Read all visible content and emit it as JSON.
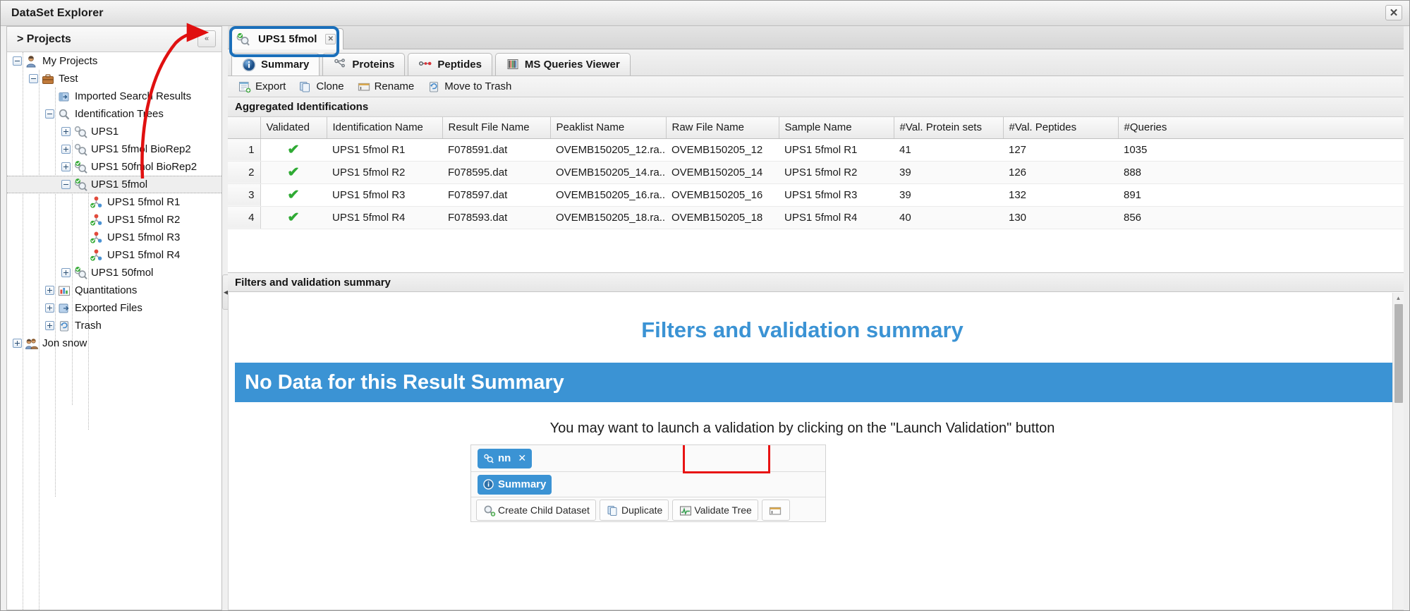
{
  "window": {
    "title": "DataSet Explorer",
    "close_label": "✕"
  },
  "sidebar": {
    "header": "> Projects",
    "collapse_icon": "«",
    "items": [
      {
        "label": "My Projects",
        "icon": "user-icon",
        "indent": 0,
        "toggle": "minus",
        "selected": false
      },
      {
        "label": "Test",
        "icon": "briefcase-icon",
        "indent": 1,
        "toggle": "minus",
        "selected": false
      },
      {
        "label": "Imported Search Results",
        "icon": "import-icon",
        "indent": 2,
        "toggle": "none",
        "selected": false
      },
      {
        "label": "Identification Trees",
        "icon": "magnifier-icon",
        "indent": 2,
        "toggle": "minus",
        "selected": false
      },
      {
        "label": "UPS1",
        "icon": "id-tree-icon",
        "indent": 3,
        "toggle": "plus",
        "selected": false
      },
      {
        "label": "UPS1 5fmol BioRep2",
        "icon": "id-tree-icon",
        "indent": 3,
        "toggle": "plus",
        "selected": false
      },
      {
        "label": "UPS1 50fmol BioRep2",
        "icon": "id-tree-valid-icon",
        "indent": 3,
        "toggle": "plus",
        "selected": false
      },
      {
        "label": "UPS1 5fmol",
        "icon": "id-tree-valid-icon",
        "indent": 3,
        "toggle": "minus",
        "selected": true
      },
      {
        "label": "UPS1 5fmol R1",
        "icon": "rset-valid-icon",
        "indent": 4,
        "toggle": "none",
        "selected": false
      },
      {
        "label": "UPS1 5fmol R2",
        "icon": "rset-valid-icon",
        "indent": 4,
        "toggle": "none",
        "selected": false
      },
      {
        "label": "UPS1 5fmol R3",
        "icon": "rset-valid-icon",
        "indent": 4,
        "toggle": "none",
        "selected": false
      },
      {
        "label": "UPS1 5fmol R4",
        "icon": "rset-valid-icon",
        "indent": 4,
        "toggle": "none",
        "selected": false
      },
      {
        "label": "UPS1 50fmol",
        "icon": "id-tree-valid-icon",
        "indent": 3,
        "toggle": "plus",
        "selected": false
      },
      {
        "label": "Quantitations",
        "icon": "barchart-icon",
        "indent": 2,
        "toggle": "plus",
        "selected": false
      },
      {
        "label": "Exported Files",
        "icon": "exported-files-icon",
        "indent": 2,
        "toggle": "plus",
        "selected": false
      },
      {
        "label": "Trash",
        "icon": "trash-icon",
        "indent": 2,
        "toggle": "plus",
        "selected": false
      },
      {
        "label": "Jon snow",
        "icon": "users-icon",
        "indent": 0,
        "toggle": "plus",
        "selected": false
      }
    ]
  },
  "document_tab": {
    "label": "UPS1 5fmol",
    "icon": "id-tree-valid-icon",
    "close_label": "✕"
  },
  "inner_tabs": [
    {
      "label": "Summary",
      "icon": "info-icon",
      "active": true
    },
    {
      "label": "Proteins",
      "icon": "proteins-icon",
      "active": false
    },
    {
      "label": "Peptides",
      "icon": "peptides-icon",
      "active": false
    },
    {
      "label": "MS Queries Viewer",
      "icon": "ms-queries-icon",
      "active": false
    }
  ],
  "toolbar": [
    {
      "label": "Export",
      "icon": "export-icon"
    },
    {
      "label": "Clone",
      "icon": "clone-icon"
    },
    {
      "label": "Rename",
      "icon": "rename-icon"
    },
    {
      "label": "Move to Trash",
      "icon": "trash-icon"
    }
  ],
  "aggregated": {
    "section_title": "Aggregated Identifications",
    "columns": [
      "",
      "Validated",
      "Identification Name",
      "Result File Name",
      "Peaklist Name",
      "Raw File Name",
      "Sample Name",
      "#Val. Protein sets",
      "#Val. Peptides",
      "#Queries"
    ],
    "rows": [
      {
        "num": "1",
        "validated": "✔",
        "identification_name": "UPS1 5fmol R1",
        "result_file_name": "F078591.dat",
        "peaklist_name": "OVEMB150205_12.ra...",
        "raw_file_name": "OVEMB150205_12",
        "sample_name": "UPS1 5fmol R1",
        "val_protein_sets": "41",
        "val_peptides": "127",
        "queries": "1035"
      },
      {
        "num": "2",
        "validated": "✔",
        "identification_name": "UPS1 5fmol R2",
        "result_file_name": "F078595.dat",
        "peaklist_name": "OVEMB150205_14.ra...",
        "raw_file_name": "OVEMB150205_14",
        "sample_name": "UPS1 5fmol R2",
        "val_protein_sets": "39",
        "val_peptides": "126",
        "queries": "888"
      },
      {
        "num": "3",
        "validated": "✔",
        "identification_name": "UPS1 5fmol R3",
        "result_file_name": "F078597.dat",
        "peaklist_name": "OVEMB150205_16.ra...",
        "raw_file_name": "OVEMB150205_16",
        "sample_name": "UPS1 5fmol R3",
        "val_protein_sets": "39",
        "val_peptides": "132",
        "queries": "891"
      },
      {
        "num": "4",
        "validated": "✔",
        "identification_name": "UPS1 5fmol R4",
        "result_file_name": "F078593.dat",
        "peaklist_name": "OVEMB150205_18.ra...",
        "raw_file_name": "OVEMB150205_18",
        "sample_name": "UPS1 5fmol R4",
        "val_protein_sets": "40",
        "val_peptides": "130",
        "queries": "856"
      }
    ]
  },
  "bottom_panel": {
    "header": "Filters and validation summary",
    "heading": "Filters and validation summary",
    "no_data_banner": "No Data for this Result Summary",
    "hint": "You may want to launch a validation by clicking on the \"Launch Validation\" button",
    "embedded": {
      "tab_label": "nn",
      "tab_close": "✕",
      "tab_icon": "id-tree-icon",
      "summary_label": "Summary",
      "summary_icon": "info-icon",
      "buttons": [
        {
          "label": "Create Child Dataset",
          "icon": "magnifier-plus-icon"
        },
        {
          "label": "Duplicate",
          "icon": "duplicate-icon"
        },
        {
          "label": "Validate Tree",
          "icon": "validate-tree-icon"
        },
        {
          "label": "",
          "icon": "rename-icon"
        }
      ]
    }
  },
  "annotations": {
    "arrow_color": "#e01010",
    "highlight_color": "#1a6fba",
    "redbox_color": "#e81313"
  },
  "colors": {
    "accent_blue": "#3b93d4",
    "valid_green": "#2faa34",
    "highlight_blue": "#1a6fba",
    "annotation_red": "#e01010"
  }
}
